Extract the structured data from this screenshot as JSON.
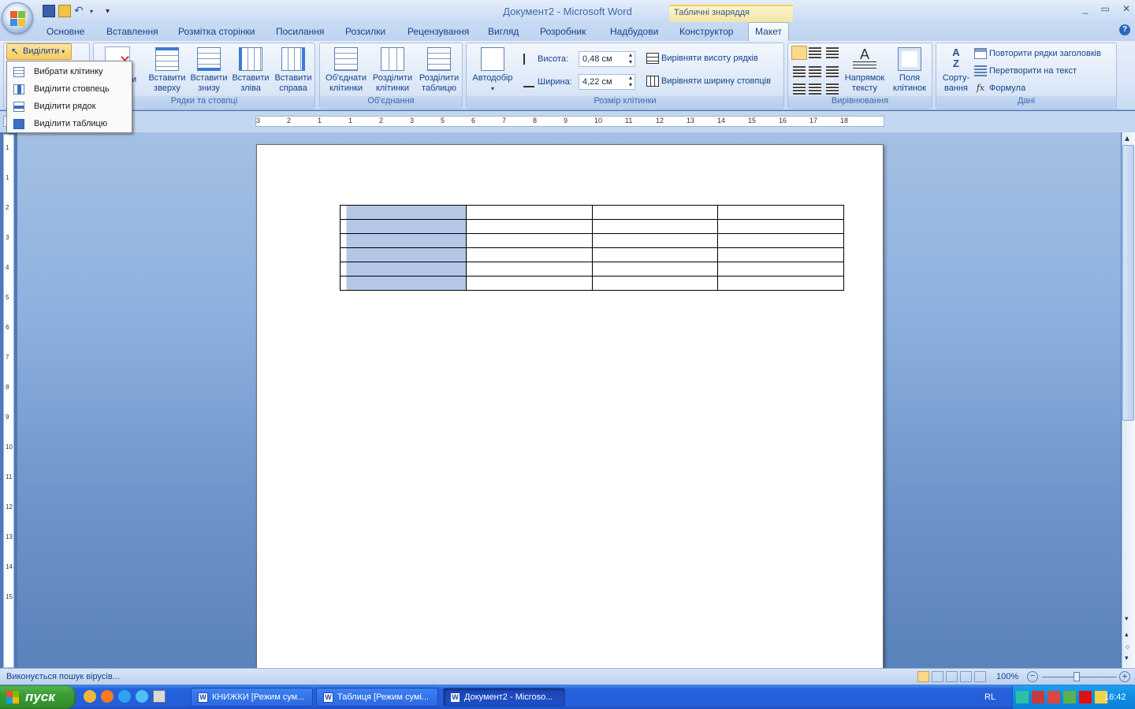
{
  "window": {
    "title": "Документ2 - Microsoft Word",
    "context_tools": "Табличні знаряддя",
    "controls": [
      "_",
      "▭",
      "✕"
    ]
  },
  "tabs": [
    {
      "label": "Основне"
    },
    {
      "label": "Вставлення"
    },
    {
      "label": "Розмітка сторінки"
    },
    {
      "label": "Посилання"
    },
    {
      "label": "Розсилки"
    },
    {
      "label": "Рецензування"
    },
    {
      "label": "Вигляд"
    },
    {
      "label": "Розробник"
    },
    {
      "label": "Надбудови"
    },
    {
      "label": "Конструктор"
    },
    {
      "label": "Макет"
    }
  ],
  "ribbon": {
    "select_button": "Виділити",
    "select_menu": [
      "Вибрати клітинку",
      "Виділити стовпець",
      "Виділити рядок",
      "Виділити таблицю"
    ],
    "delete_partial": "и",
    "rows_cols": {
      "group": "Рядки та стовпці",
      "above": "Вставити зверху",
      "below": "Вставити знизу",
      "left": "Вставити зліва",
      "right": "Вставити справа"
    },
    "merge": {
      "group": "Об'єднання",
      "merge_cells": "Об'єднати клітинки",
      "split_cells": "Розділити клітинки",
      "split_table": "Розділити таблицю"
    },
    "cell_size": {
      "group": "Розмір клітинки",
      "autofit": "Автодобір",
      "height_label": "Висота:",
      "height_value": "0,48 см",
      "width_label": "Ширина:",
      "width_value": "4,22 см",
      "distribute_rows": "Вирівняти висоту рядків",
      "distribute_cols": "Вирівняти ширину стовпців"
    },
    "alignment": {
      "group": "Вирівнювання",
      "text_direction": "Напрямок тексту",
      "cell_margins": "Поля клітинок"
    },
    "data": {
      "group": "Дані",
      "sort": "Сорту-вання",
      "repeat_header": "Повторити рядки заголовків",
      "convert": "Перетворити на текст",
      "formula": "Формула"
    }
  },
  "ruler": {
    "h_labels": [
      "3",
      "2",
      "1",
      "1",
      "2",
      "3",
      "5",
      "6",
      "7",
      "8",
      "9",
      "10",
      "11",
      "12",
      "13",
      "14",
      "15",
      "16",
      "17",
      "18"
    ],
    "v_labels": [
      "1",
      "1",
      "2",
      "3",
      "4",
      "5",
      "6",
      "7",
      "8",
      "9",
      "10",
      "11",
      "12",
      "13",
      "14",
      "15"
    ]
  },
  "table": {
    "rows": 6,
    "cols": 4,
    "selected_col": 0
  },
  "status": {
    "text": "Виконується пошук вірусів...",
    "zoom": "100%"
  },
  "taskbar": {
    "start": "пуск",
    "tasks": [
      "КНИЖКИ [Режим сум...",
      "Таблиця [Режим сумі...",
      "Документ2 - Microso..."
    ],
    "lang": "RL",
    "clock": "16:42"
  },
  "colors": {
    "selection": "#b4c7e7",
    "accent": "#fbc95c"
  }
}
